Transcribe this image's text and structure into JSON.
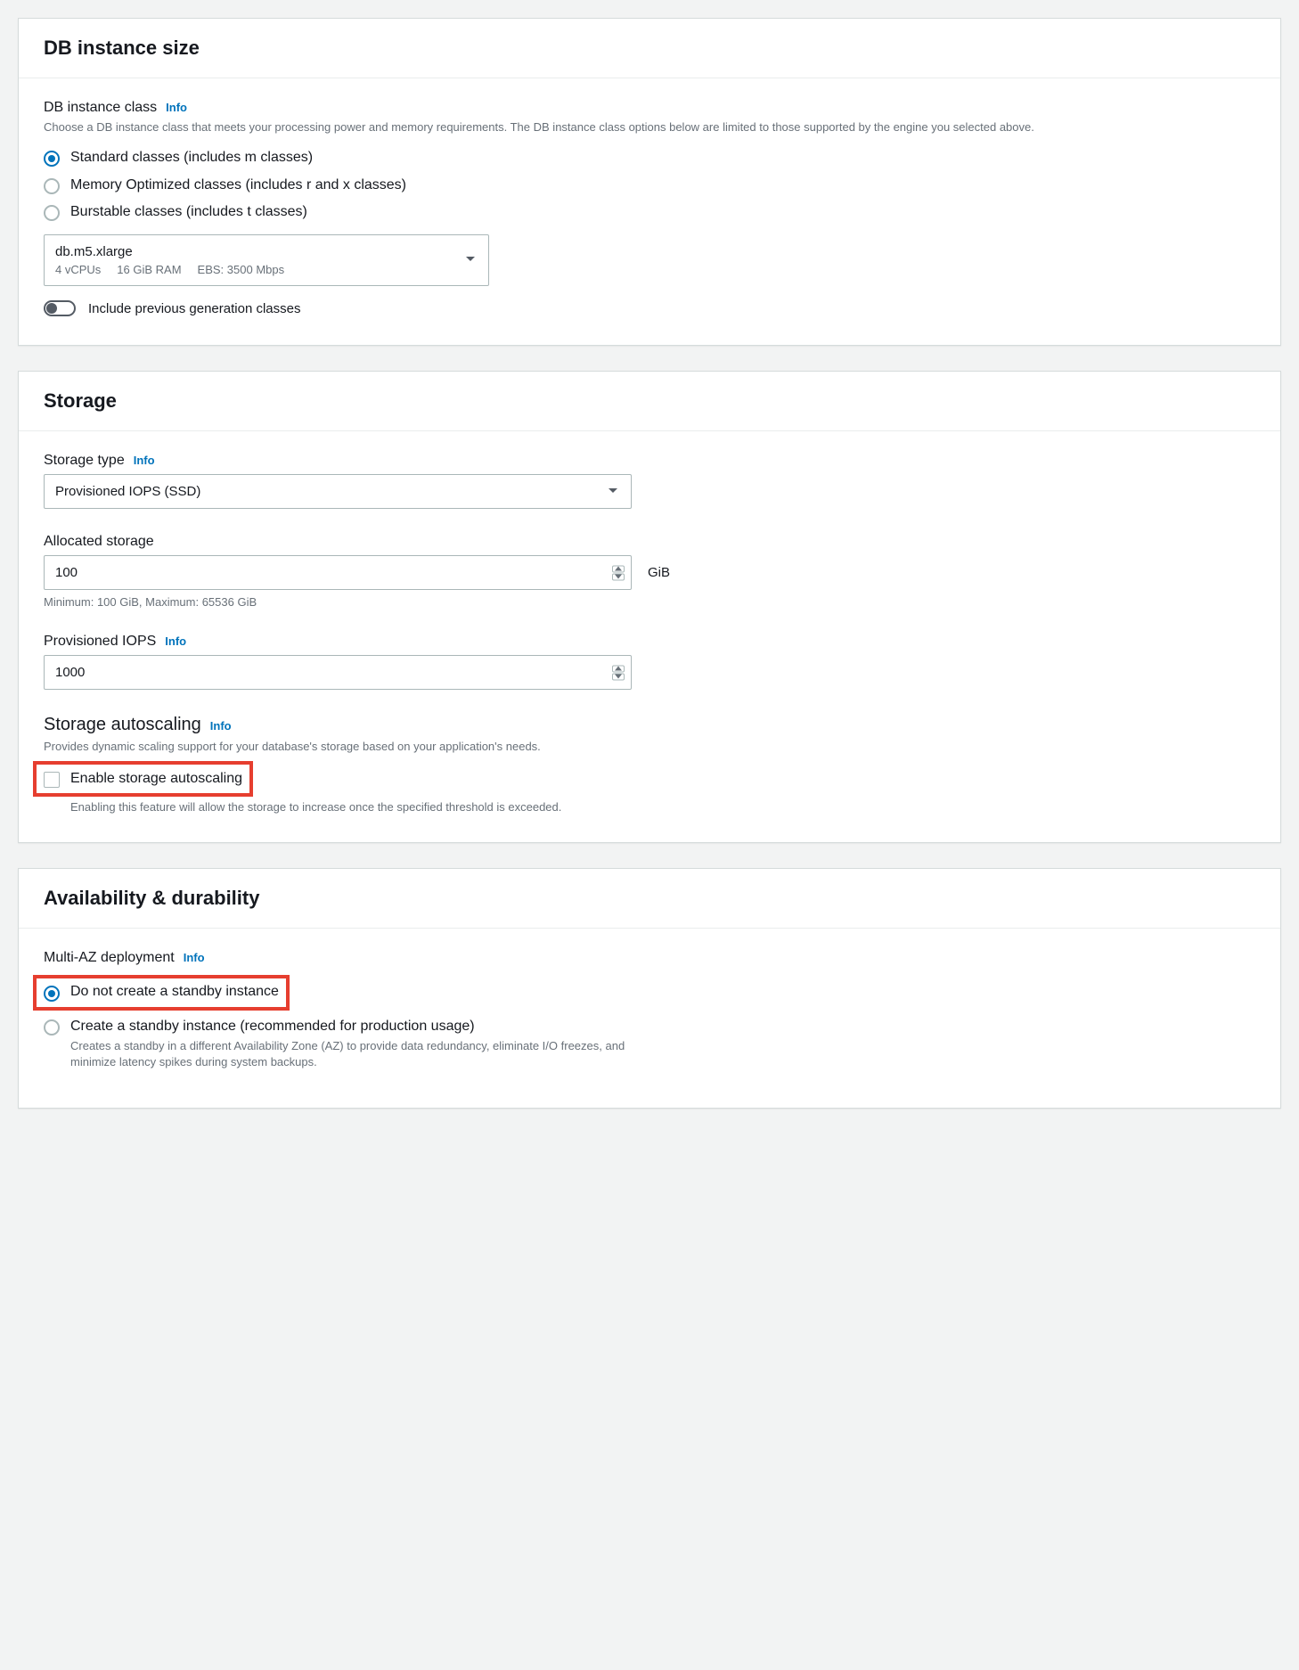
{
  "db_instance_size": {
    "title": "DB instance size",
    "class_label": "DB instance class",
    "class_info": "Info",
    "class_desc": "Choose a DB instance class that meets your processing power and memory requirements. The DB instance class options below are limited to those supported by the engine you selected above.",
    "options": {
      "standard": "Standard classes (includes m classes)",
      "memory": "Memory Optimized classes (includes r and x classes)",
      "burstable": "Burstable classes (includes t classes)"
    },
    "select": {
      "value": "db.m5.xlarge",
      "vcpu": "4 vCPUs",
      "ram": "16 GiB RAM",
      "ebs": "EBS: 3500 Mbps"
    },
    "toggle_label": "Include previous generation classes"
  },
  "storage": {
    "title": "Storage",
    "type_label": "Storage type",
    "type_info": "Info",
    "type_value": "Provisioned IOPS (SSD)",
    "allocated_label": "Allocated storage",
    "allocated_value": "100",
    "allocated_unit": "GiB",
    "allocated_hint": "Minimum: 100 GiB, Maximum: 65536 GiB",
    "iops_label": "Provisioned IOPS",
    "iops_info": "Info",
    "iops_value": "1000",
    "autoscaling_label": "Storage autoscaling",
    "autoscaling_info": "Info",
    "autoscaling_desc": "Provides dynamic scaling support for your database's storage based on your application's needs.",
    "enable_label": "Enable storage autoscaling",
    "enable_desc": "Enabling this feature will allow the storage to increase once the specified threshold is exceeded."
  },
  "availability": {
    "title": "Availability & durability",
    "multi_az_label": "Multi-AZ deployment",
    "multi_az_info": "Info",
    "no_standby": "Do not create a standby instance",
    "create_standby": "Create a standby instance (recommended for production usage)",
    "create_standby_desc": "Creates a standby in a different Availability Zone (AZ) to provide data redundancy, eliminate I/O freezes, and minimize latency spikes during system backups."
  }
}
